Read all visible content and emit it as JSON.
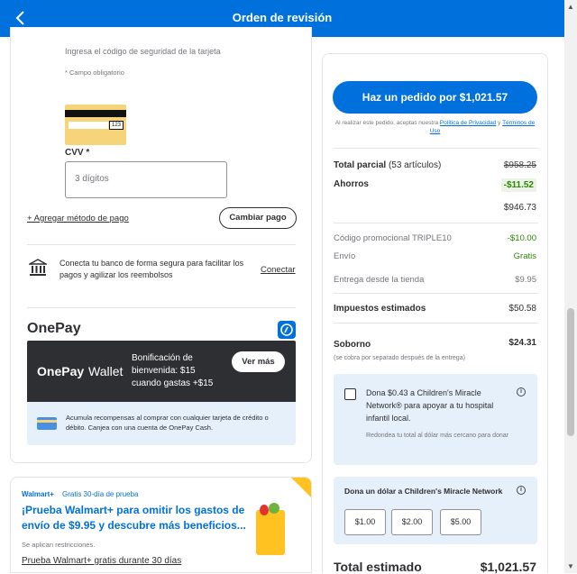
{
  "header": {
    "title": "Orden de revisión",
    "back_icon": "chevron-left-icon"
  },
  "payment": {
    "security_hint": "Ingresa el código de seguridad de la tarjeta",
    "required_note": "* Campo obligatorio",
    "card_code_sample": "123",
    "cvv_label": "CVV *",
    "cvv_placeholder": "3 dígitos",
    "add_method_link": "+ Agregar método de pago",
    "change_payment_button": "Cambiar pago",
    "bank_text": "Conecta tu banco de forma segura para facilitar los pagos y agilizar los reembolsos",
    "connect_link": "Conectar"
  },
  "onepay": {
    "logo": "OnePay",
    "wallet_brand": "OnePay",
    "wallet_word": "Wallet",
    "bonus_text": "Bonificación de bienvenida: $15 cuando gastas +$15",
    "see_more_button": "Ver más",
    "rewards_text": "Acumula recompensas al comprar con cualquier tarjeta de crédito o débito. Canjea con una cuenta de OnePay Cash."
  },
  "promo": {
    "badge": "Walmart+",
    "trial_label": "Gratis 30-día de prueba",
    "headline": "¡Prueba Walmart+ para omitir los gastos de envío de $9.95 y descubre más beneficios...",
    "restrictions": "Se aplican restricciones.",
    "trial_link": "Prueba Walmart+ gratis durante 30 días"
  },
  "summary": {
    "place_order_button": "Haz un pedido por $1,021.57",
    "legal_prefix": "Al realizar este pedido, aceptas nuestra ",
    "privacy_link": "Política de Privacidad",
    "legal_and": " y ",
    "terms_link": "Términos de Uso",
    "subtotal_label": "Total parcial",
    "subtotal_items": "(53 artículos)",
    "subtotal_value": "$958.25",
    "savings_label": "Ahorros",
    "savings_value": "-$11.52",
    "after_savings_value": "$946.73",
    "promo_code_label": "Código promocional TRIPLE10",
    "promo_code_value": "-$10.00",
    "shipping_label": "Envío",
    "shipping_value": "Gratis",
    "store_delivery_label": "Entrega desde la tienda",
    "store_delivery_value": "$9.95",
    "taxes_label": "Impuestos estimados",
    "taxes_value": "$50.58",
    "bribe_label": "Soborno",
    "bribe_value": "$24.31",
    "bribe_note": "(se cobra por separado después de la entrega)",
    "donate_text": "Dona $0.43 a Children's Miracle Network® para apoyar a tu hospital infantil local.",
    "donate_note": "Redondea tu total al dólar más cercano para donar",
    "donate_dollar_title": "Dona un dólar a Children's Miracle Network",
    "donate_options": [
      "$1.00",
      "$2.00",
      "$5.00"
    ],
    "estimated_total_label": "Total estimado",
    "estimated_total_value": "$1,021.57"
  },
  "colors": {
    "brand_blue": "#0071dc",
    "green": "#2a8703",
    "savings_bg": "#eaf3e6",
    "light_blue": "#e6f0fa",
    "dark": "#2e2f32"
  }
}
